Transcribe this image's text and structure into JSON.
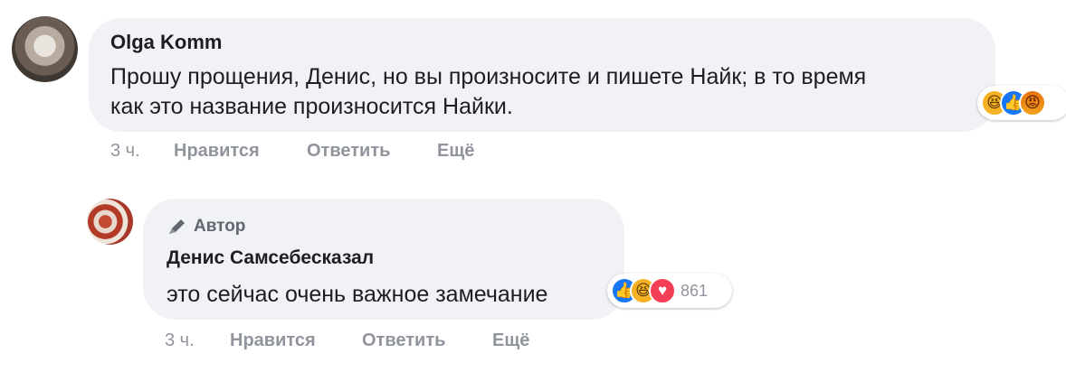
{
  "comments": [
    {
      "author": "Olga Komm",
      "text_line1": "Прошу прощения, Денис, но вы произносите и пишете Найк; в то время",
      "text_line2": "как это название произносится Найки.",
      "time": "3 ч.",
      "like_label": "Нравится",
      "reply_label": "Ответить",
      "more_label": "Ещё",
      "reactions": [
        "haha",
        "like",
        "angry"
      ]
    },
    {
      "author_badge": "Автор",
      "author": "Денис Самсебесказал",
      "text": "это сейчас очень важное замечание",
      "time": "3 ч.",
      "like_label": "Нравится",
      "reply_label": "Ответить",
      "more_label": "Ещё",
      "reactions": [
        "like",
        "haha",
        "love"
      ],
      "reaction_count": "861"
    }
  ],
  "colors": {
    "bubble": "#f0f2f5",
    "meta_text": "#90949c",
    "like": "#1877f2",
    "haha": "#f7b125",
    "love": "#f33e58",
    "angry": "#e9710f"
  }
}
